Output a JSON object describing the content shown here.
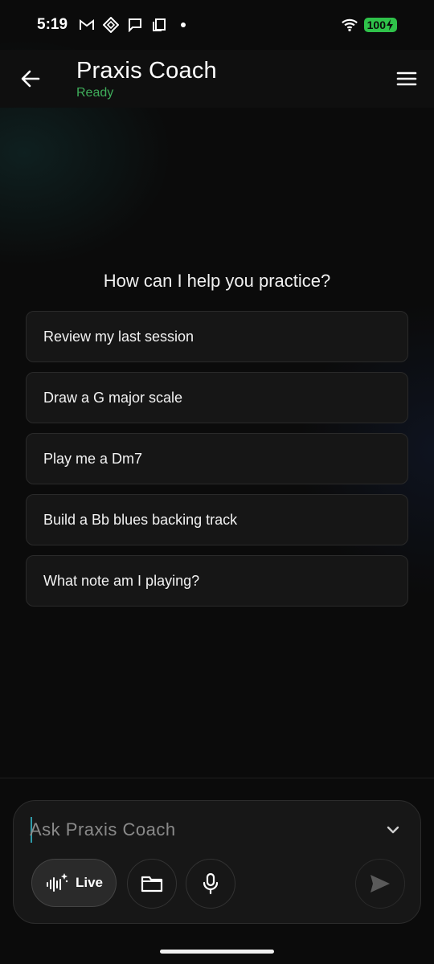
{
  "status_bar": {
    "time": "5:19",
    "icons": [
      "gmail-icon",
      "app-diamond-icon",
      "chat-icon",
      "copy-icon",
      "dot-icon"
    ],
    "battery": "100",
    "battery_color": "#2fc24a"
  },
  "header": {
    "title": "Praxis Coach",
    "status": "Ready",
    "status_color": "#3fae5b"
  },
  "main": {
    "prompt": "How can I help you practice?",
    "suggestions": [
      "Review my last session",
      "Draw a G major scale",
      "Play me a Dm7",
      "Build a Bb blues backing track",
      "What note am I playing?"
    ]
  },
  "composer": {
    "placeholder": "Ask Praxis Coach",
    "value": "",
    "live_label": "Live",
    "accent": "#2f9aa8"
  }
}
